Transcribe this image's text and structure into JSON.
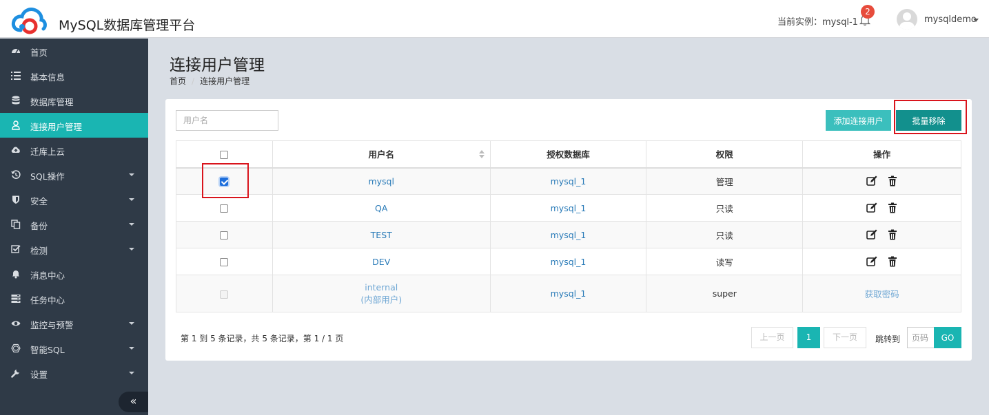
{
  "header": {
    "app_title": "MySQL数据库管理平台",
    "instance_label": "当前实例：mysql-1",
    "notification_count": "2",
    "username": "mysqldemo"
  },
  "sidebar": {
    "items": [
      {
        "label": "首页",
        "icon": "dashboard-icon",
        "has_submenu": false,
        "active": false
      },
      {
        "label": "基本信息",
        "icon": "list-icon",
        "has_submenu": false,
        "active": false
      },
      {
        "label": "数据库管理",
        "icon": "database-icon",
        "has_submenu": false,
        "active": false
      },
      {
        "label": "连接用户管理",
        "icon": "user-icon",
        "has_submenu": false,
        "active": true
      },
      {
        "label": "迁库上云",
        "icon": "cloud-upload-icon",
        "has_submenu": false,
        "active": false
      },
      {
        "label": "SQL操作",
        "icon": "history-icon",
        "has_submenu": true,
        "active": false
      },
      {
        "label": "安全",
        "icon": "shield-icon",
        "has_submenu": true,
        "active": false
      },
      {
        "label": "备份",
        "icon": "copy-icon",
        "has_submenu": true,
        "active": false
      },
      {
        "label": "检测",
        "icon": "check-square-icon",
        "has_submenu": true,
        "active": false
      },
      {
        "label": "消息中心",
        "icon": "bell-icon",
        "has_submenu": false,
        "active": false
      },
      {
        "label": "任务中心",
        "icon": "server-icon",
        "has_submenu": false,
        "active": false
      },
      {
        "label": "监控与预警",
        "icon": "eye-icon",
        "has_submenu": true,
        "active": false
      },
      {
        "label": "智能SQL",
        "icon": "hexagon-icon",
        "has_submenu": true,
        "active": false
      },
      {
        "label": "设置",
        "icon": "wrench-icon",
        "has_submenu": true,
        "active": false
      }
    ],
    "collapse_label": "«"
  },
  "main": {
    "title": "连接用户管理",
    "breadcrumb": [
      "首页",
      "连接用户管理"
    ],
    "search_placeholder": "用户名",
    "add_button": "添加连接用户",
    "batch_remove_button": "批量移除",
    "table": {
      "headers": [
        "用户名",
        "授权数据库",
        "权限",
        "操作"
      ],
      "rows": [
        {
          "username": "mysql",
          "database": "mysql_1",
          "permission": "管理",
          "checked": true
        },
        {
          "username": "QA",
          "database": "mysql_1",
          "permission": "只读",
          "checked": false
        },
        {
          "username": "TEST",
          "database": "mysql_1",
          "permission": "只读",
          "checked": false
        },
        {
          "username": "DEV",
          "database": "mysql_1",
          "permission": "读写",
          "checked": false
        }
      ],
      "internal_row": {
        "username": "internal",
        "username_note": "(内部用户)",
        "database": "mysql_1",
        "permission": "super",
        "action": "获取密码"
      }
    },
    "pagination": {
      "info": "第 1 到 5 条记录，共 5 条记录，第 1 / 1 页",
      "prev": "上一页",
      "current": "1",
      "next": "下一页",
      "jump_label": "跳转到",
      "page_placeholder": "页码",
      "go": "GO"
    }
  },
  "colors": {
    "accent": "#1ab5b2",
    "sidebar_bg": "#2f3a47",
    "highlight_box": "#d9141c",
    "link": "#2a7bb8"
  }
}
